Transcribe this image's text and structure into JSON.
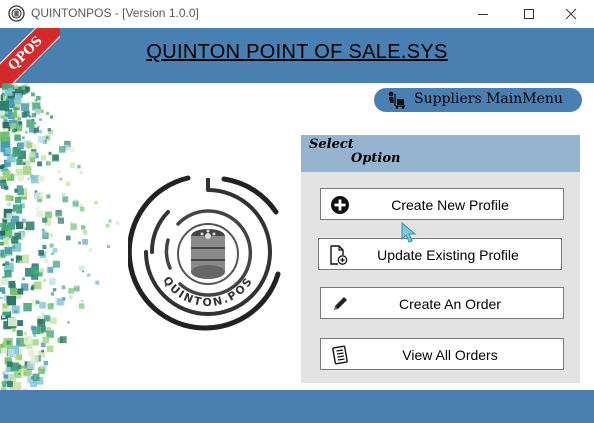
{
  "window": {
    "title": "QUINTONPOS - [Version 1.0.0]",
    "icons": [
      "app-icon",
      "minimize-icon",
      "maximize-icon",
      "close-icon"
    ]
  },
  "header": {
    "title": "QUINTON POINT OF SALE.SYS",
    "ribbon_text": "QPOS",
    "colors": {
      "bar": "#4a7fb2",
      "ribbon": "#d42a2a"
    }
  },
  "suppliers_menu": {
    "label": "Suppliers MainMenu",
    "icon": "supplier-trolley-icon"
  },
  "logo": {
    "text": "QUINTON.POS"
  },
  "options_panel": {
    "heading_line1": "Select",
    "heading_line2": "Option",
    "buttons": [
      {
        "label": "Create New Profile",
        "icon": "plus-circle-icon"
      },
      {
        "label": "Update Existing Profile",
        "icon": "document-add-icon"
      },
      {
        "label": "Create An Order",
        "icon": "pencil-icon"
      },
      {
        "label": "View All Orders",
        "icon": "order-list-icon"
      }
    ]
  }
}
